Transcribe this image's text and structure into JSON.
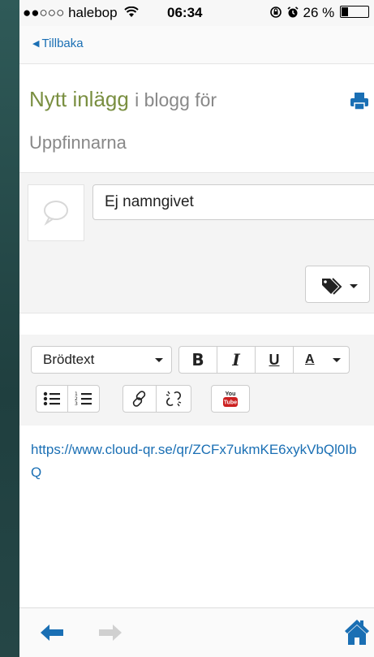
{
  "status_bar": {
    "carrier": "●●○○○ halebop",
    "time": "06:34",
    "battery_percent": "26 %",
    "battery_level": 0.26
  },
  "nav": {
    "back_label": "Tillbaka"
  },
  "header": {
    "title_main": "Nytt inlägg",
    "title_sub": "i blogg för",
    "blog_name": "Uppfinnarna",
    "print_icon": "print-icon"
  },
  "post": {
    "title_value": "Ej namngivet",
    "tags_icon": "tags-icon"
  },
  "toolbar": {
    "format_label": "Brödtext",
    "bold_label": "B",
    "italic_label": "I",
    "underline_label": "U",
    "color_label": "A",
    "youtube_label_top": "You",
    "youtube_label_bottom": "Tube"
  },
  "editor": {
    "content": "https://www.cloud-qr.se/qr/ZCFx7ukmKE6xykVbQl0IbQ"
  },
  "colors": {
    "link_blue": "#1a6fb4",
    "title_green": "#7a8f41",
    "youtube_red": "#cc2020"
  }
}
